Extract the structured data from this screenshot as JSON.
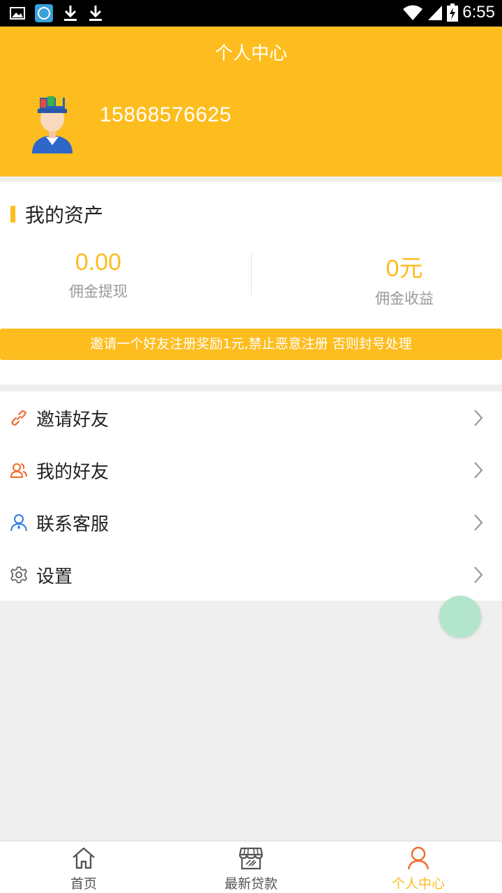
{
  "status_bar": {
    "time": "6:55",
    "left_icons": [
      "image-icon",
      "app-notification-icon",
      "download-icon",
      "download-icon"
    ],
    "right_icons": [
      "wifi-icon",
      "signal-icon",
      "battery-charging-icon"
    ]
  },
  "header": {
    "title": "个人中心",
    "phone": "15868576625",
    "background_color": "#fdbd1e"
  },
  "assets": {
    "section_title": "我的资产",
    "stats": [
      {
        "value": "0.00",
        "label": "佣金提现"
      },
      {
        "value": "0元",
        "label": "佣金收益"
      }
    ],
    "notice": "邀请一个好友注册奖励1元,禁止恶意注册 否则封号处理"
  },
  "menu": {
    "items": [
      {
        "label": "邀请好友",
        "icon": "link-icon",
        "color": "#f06a2c"
      },
      {
        "label": "我的好友",
        "icon": "friends-icon",
        "color": "#f06a2c"
      },
      {
        "label": "联系客服",
        "icon": "customer-service-icon",
        "color": "#2a7de1"
      },
      {
        "label": "设置",
        "icon": "gear-icon",
        "color": "#666666"
      }
    ]
  },
  "tabbar": {
    "tabs": [
      {
        "label": "首页",
        "icon": "home-icon",
        "active": false
      },
      {
        "label": "最新贷款",
        "icon": "store-icon",
        "active": false
      },
      {
        "label": "个人中心",
        "icon": "user-icon",
        "active": true
      }
    ],
    "active_color": "#fdbd1e"
  }
}
